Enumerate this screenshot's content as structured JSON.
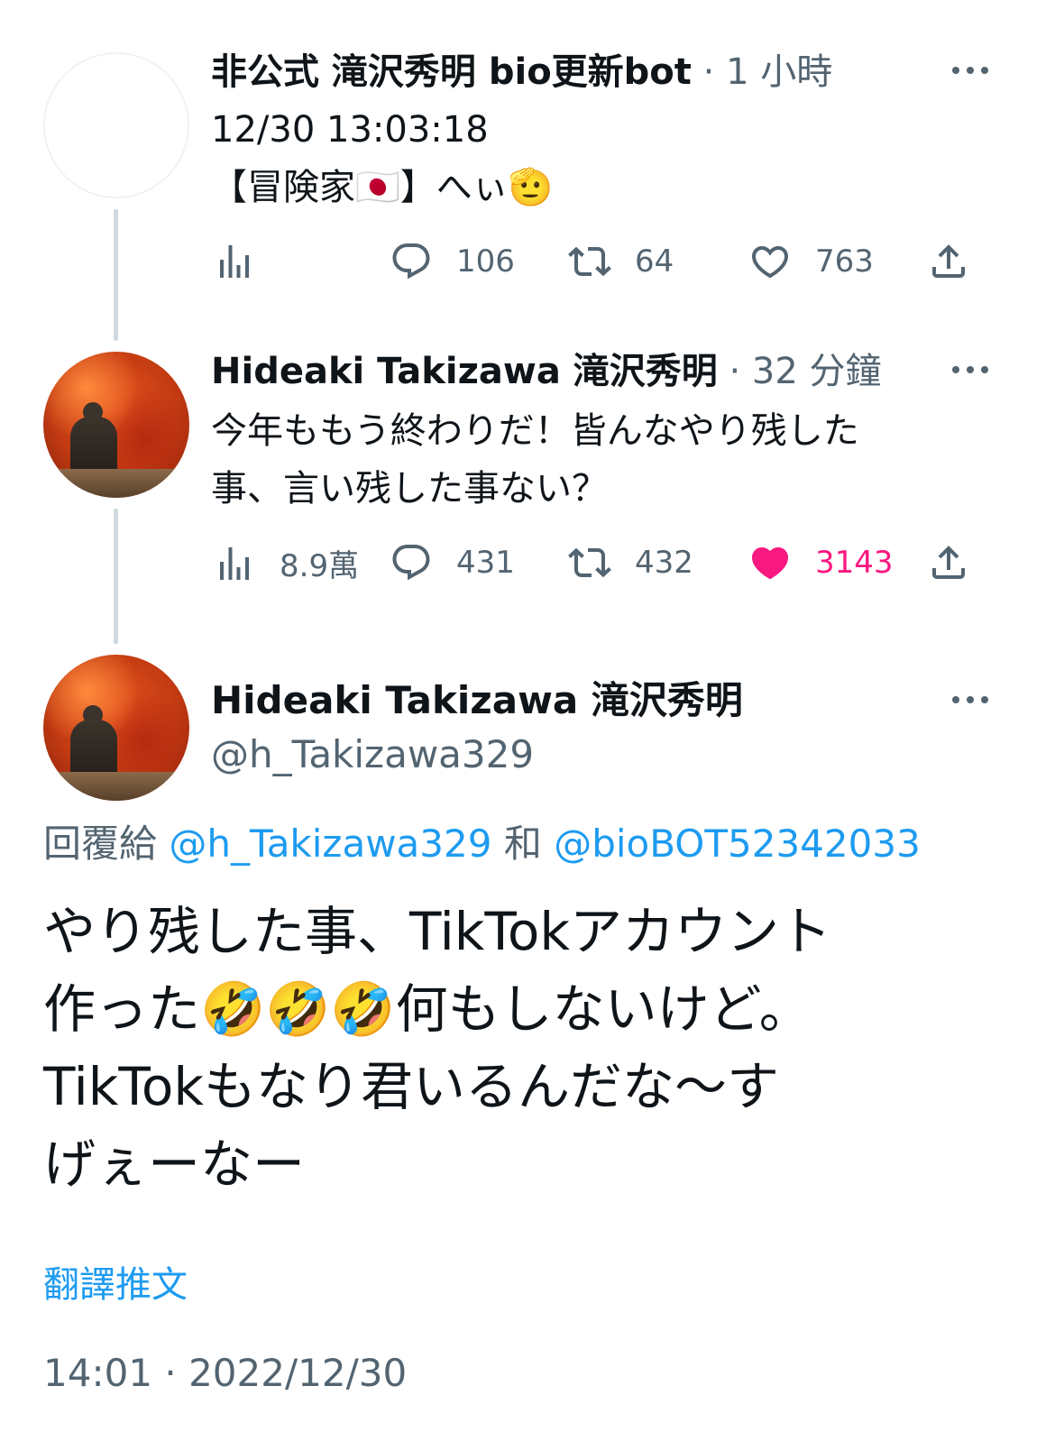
{
  "tweet1": {
    "display_name": "非公式 滝沢秀明 bio更新bot",
    "time_ago": "1 小時",
    "date_line": "12/30 13:03:18",
    "text": "【冒険家🇯🇵】へぃ🫡",
    "views": "",
    "replies": "106",
    "retweets": "64",
    "likes": "763"
  },
  "tweet2": {
    "display_name": "Hideaki Takizawa 滝沢秀明",
    "time_ago": "32 分鐘",
    "text_line1": "今年ももう終わりだ！皆んなやり残した",
    "text_line2": "事、言い残した事ない？",
    "views": "8.9萬",
    "replies": "431",
    "retweets": "432",
    "likes": "3143",
    "liked": true
  },
  "main": {
    "display_name": "Hideaki Takizawa 滝沢秀明",
    "handle": "@h_Takizawa329",
    "reply_prefix": "回覆給",
    "reply_user1": "@h_Takizawa329",
    "reply_and": "和",
    "reply_user2": "@bioBOT52342033",
    "text": "やり残した事、TikTokアカウント\n作った🤣🤣🤣何もしないけど。\nTikTokもなり君いるんだな〜す\nげぇーなー",
    "translate_label": "翻譯推文",
    "timestamp": "14:01 · 2022/12/30"
  },
  "colors": {
    "accent": "#1d9bf0",
    "like": "#f91880",
    "muted": "#536471"
  }
}
